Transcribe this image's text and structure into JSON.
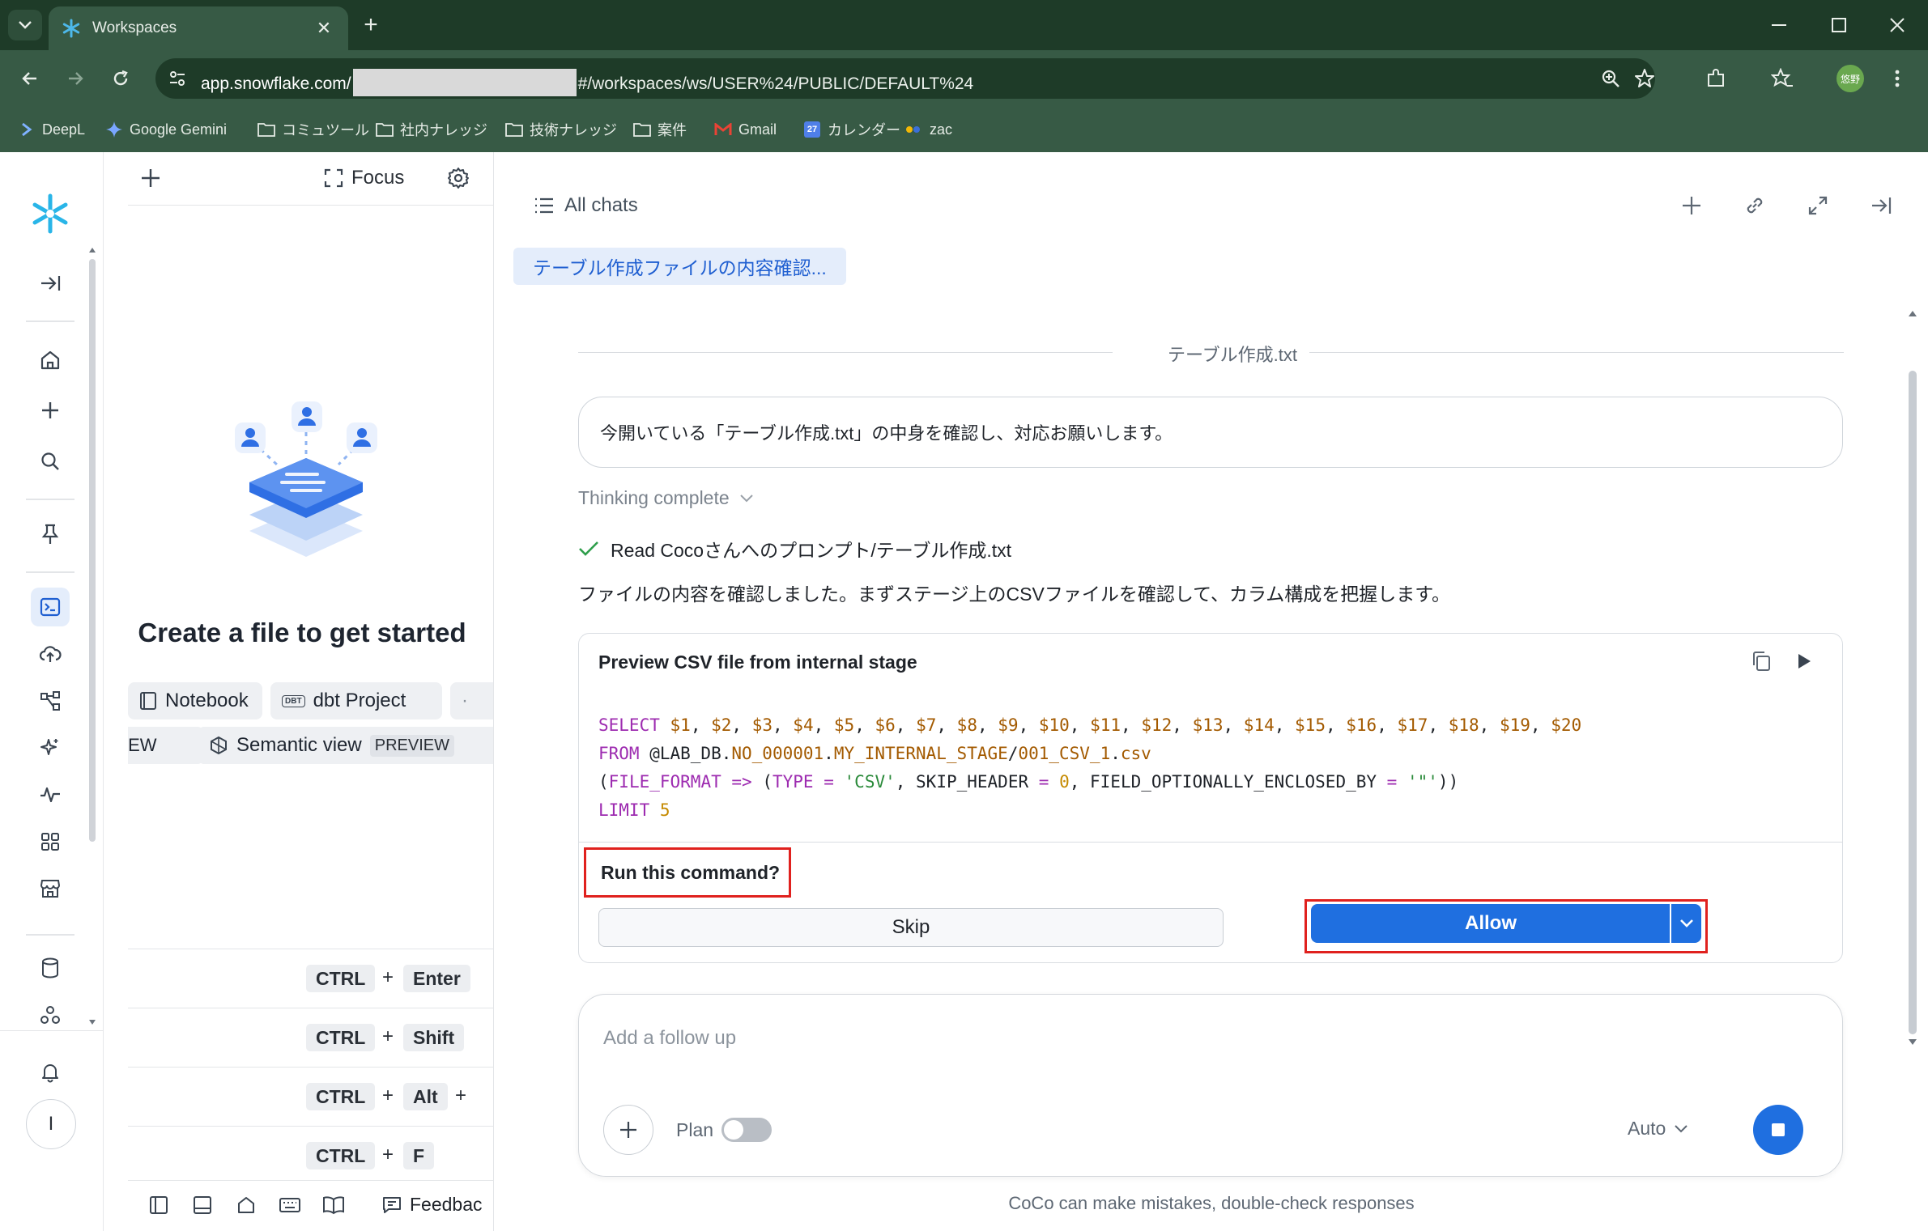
{
  "browser": {
    "tab_title": "Workspaces",
    "url_host": "app.snowflake.com/",
    "url_path": "#/workspaces/ws/USER%24/PUBLIC/DEFAULT%24",
    "profile_initials": "悠野",
    "bookmarks": [
      {
        "label": "DeepL",
        "icon": "deepl-icon"
      },
      {
        "label": "Google Gemini",
        "icon": "gemini-icon"
      },
      {
        "label": "コミュツール",
        "icon": "folder-icon"
      },
      {
        "label": "社内ナレッジ",
        "icon": "folder-icon"
      },
      {
        "label": "技術ナレッジ",
        "icon": "folder-icon"
      },
      {
        "label": "案件",
        "icon": "folder-icon"
      },
      {
        "label": "Gmail",
        "icon": "gmail-icon"
      },
      {
        "label": "カレンダー",
        "icon": "calendar-icon"
      },
      {
        "label": "zac",
        "icon": "zac-icon"
      }
    ],
    "calendar_day": "27"
  },
  "rail": {
    "user_initial": "I"
  },
  "file_panel": {
    "focus_label": "Focus",
    "cta_title": "Create a file to get started",
    "chips_row1": [
      "Notebook",
      "dbt Project"
    ],
    "chips_row1_badge": "DBT",
    "chips_row2_left": "IEW",
    "chips_row2": "Semantic view",
    "chips_row2_badge": "PREVIEW",
    "shortcuts": [
      {
        "keys": [
          "CTRL",
          "Enter"
        ],
        "trailing_plus": false
      },
      {
        "keys": [
          "CTRL",
          "Shift"
        ],
        "trailing_plus": false
      },
      {
        "keys": [
          "CTRL",
          "Alt"
        ],
        "trailing_plus": true
      },
      {
        "keys": [
          "CTRL",
          "F"
        ],
        "trailing_plus": false
      }
    ],
    "feedback_label": "Feedbac"
  },
  "chat": {
    "all_chats_label": "All chats",
    "chat_tag": "テーブル作成ファイルの内容確認...",
    "file_divider": "テーブル作成.txt",
    "user_message": "今開いている「テーブル作成.txt」の中身を確認し、対応お願いします。",
    "thinking_label": "Thinking complete",
    "read_line": "Read Cocoさんへのプロンプト/テーブル作成.txt",
    "response_text": "ファイルの内容を確認しました。まずステージ上のCSVファイルを確認して、カラム構成を把握します。",
    "tool_card": {
      "title": "Preview CSV file from internal stage",
      "run_question": "Run this command?",
      "skip_label": "Skip",
      "allow_label": "Allow"
    },
    "composer": {
      "placeholder": "Add a follow up",
      "plan_label": "Plan",
      "plan_enabled": false,
      "mode_label": "Auto"
    },
    "disclaimer": "CoCo can make mistakes, double-check responses"
  },
  "colors": {
    "browser_frame": "#1e3b28",
    "browser_toolbar": "#375a45",
    "accent_blue": "#1f6fe0",
    "highlight_red": "#e0211e",
    "tag_bg": "#e4edfb"
  }
}
